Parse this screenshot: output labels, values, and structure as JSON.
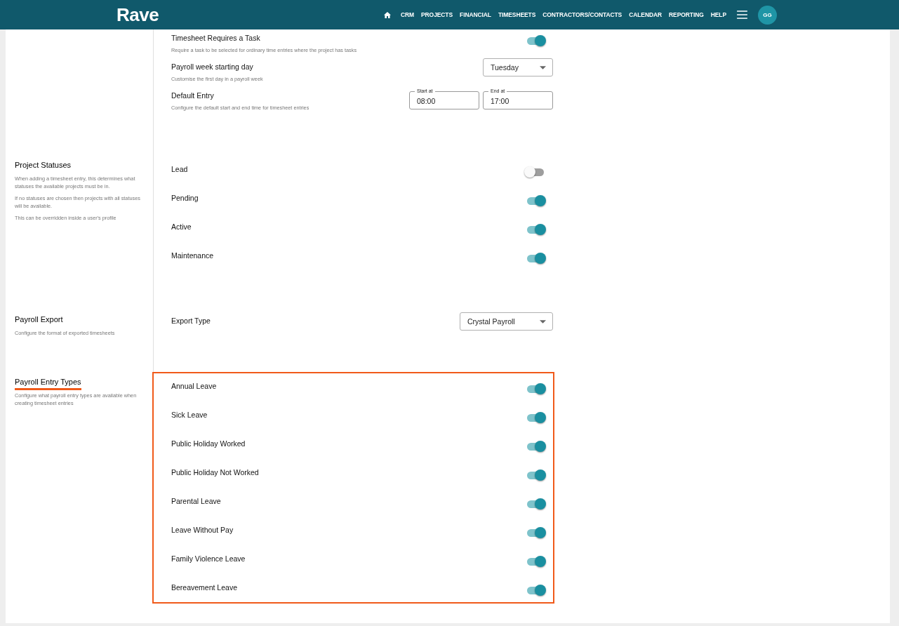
{
  "nav": {
    "logo": "Rave",
    "items": [
      {
        "kind": "home"
      },
      {
        "kind": "text",
        "label": "CRM"
      },
      {
        "kind": "text",
        "label": "PROJECTS"
      },
      {
        "kind": "text",
        "label": "FINANCIAL"
      },
      {
        "kind": "text",
        "label": "TIMESHEETS"
      },
      {
        "kind": "text",
        "label": "CONTRACTORS/CONTACTS"
      },
      {
        "kind": "text",
        "label": "CALENDAR"
      },
      {
        "kind": "text",
        "label": "REPORTING"
      },
      {
        "kind": "text",
        "label": "HELP"
      }
    ],
    "avatar": "GG"
  },
  "sections": [
    {
      "highlighted": false,
      "rows": [
        {
          "kind": "toggle",
          "label": "Timesheet Requires a Task",
          "description": "Require a task to be selected for ordinary time entries where the project has tasks",
          "on": true
        },
        {
          "kind": "select",
          "label": "Payroll week starting day",
          "description": "Customise the first day in a payroll week",
          "value": "Tuesday"
        },
        {
          "kind": "time-range",
          "label": "Default Entry",
          "description": "Configure the default start and end time for timesheet entries",
          "fields": [
            {
              "label": "Start at",
              "value": "08:00"
            },
            {
              "label": "End at",
              "value": "17:00"
            }
          ]
        }
      ]
    },
    {
      "title": "Project Statuses",
      "highlighted": false,
      "descriptions": [
        "When adding a timesheet entry, this determines what statuses the available projects must be in.",
        "If no statuses are chosen then projects with all statuses will be available.",
        "This can be overridden inside a user's profile"
      ],
      "rows": [
        {
          "kind": "toggle",
          "label": "Lead",
          "on": false
        },
        {
          "kind": "toggle",
          "label": "Pending",
          "on": true
        },
        {
          "kind": "toggle",
          "label": "Active",
          "on": true
        },
        {
          "kind": "toggle",
          "label": "Maintenance",
          "on": true
        }
      ]
    },
    {
      "title": "Payroll Export",
      "highlighted": false,
      "descriptions": [
        "Configure the format of exported timesheets"
      ],
      "rows": [
        {
          "kind": "select",
          "label": "Export Type",
          "value": "Crystal Payroll"
        }
      ]
    },
    {
      "title": "Payroll Entry Types",
      "highlighted": true,
      "descriptions": [
        "Configure what payroll entry types are available when creating timesheet entries"
      ],
      "rows": [
        {
          "kind": "toggle",
          "label": "Annual Leave",
          "on": true
        },
        {
          "kind": "toggle",
          "label": "Sick Leave",
          "on": true
        },
        {
          "kind": "toggle",
          "label": "Public Holiday Worked",
          "on": true
        },
        {
          "kind": "toggle",
          "label": "Public Holiday Not Worked",
          "on": true
        },
        {
          "kind": "toggle",
          "label": "Parental Leave",
          "on": true
        },
        {
          "kind": "toggle",
          "label": "Leave Without Pay",
          "on": true
        },
        {
          "kind": "toggle",
          "label": "Family Violence Leave",
          "on": true
        },
        {
          "kind": "toggle",
          "label": "Bereavement Leave",
          "on": true
        }
      ]
    }
  ]
}
